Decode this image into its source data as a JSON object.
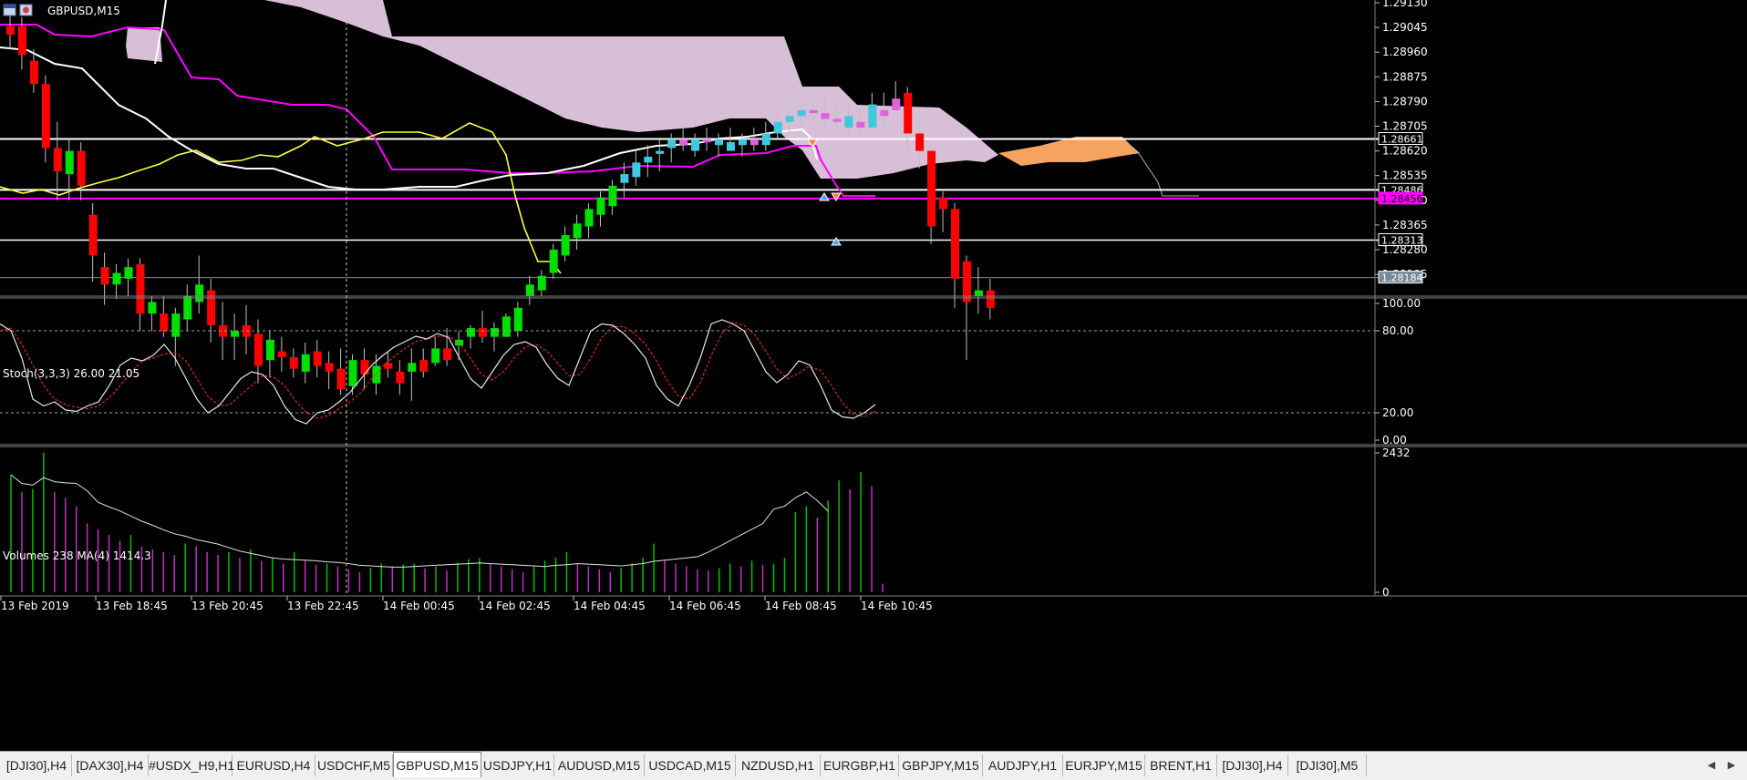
{
  "window": {
    "symbol_label": "GBPUSD,M15"
  },
  "indicators": {
    "stoch_label": "Stoch(3,3,3) 26.00 21.05",
    "volume_label": "Volumes 238 MA(4) 1414.3"
  },
  "main_axis": {
    "ticks": [
      "1.29130",
      "1.29045",
      "1.28960",
      "1.28875",
      "1.28790",
      "1.28705",
      "1.28620",
      "1.28535",
      "1.28450",
      "1.28365",
      "1.28280",
      "1.28195"
    ],
    "boxed": [
      {
        "label": "1.28661",
        "color": "#ffffff"
      },
      {
        "label": "1.28486",
        "color": "#ffffff"
      },
      {
        "label": "1.28456",
        "color": "#ff00ff"
      },
      {
        "label": "1.28313",
        "color": "#ffffff"
      },
      {
        "label": "1.28184",
        "color": "#778899"
      }
    ]
  },
  "stoch_axis": {
    "ticks": [
      "100.00",
      "80.00",
      "20.00",
      "0.00"
    ]
  },
  "volume_axis": {
    "ticks": [
      "2432",
      "0"
    ]
  },
  "time_axis": {
    "labels": [
      "13 Feb 2019",
      "13 Feb 18:45",
      "13 Feb 20:45",
      "13 Feb 22:45",
      "14 Feb 00:45",
      "14 Feb 02:45",
      "14 Feb 04:45",
      "14 Feb 06:45",
      "14 Feb 08:45",
      "14 Feb 10:45"
    ]
  },
  "tabs": [
    {
      "label": "[DJI30],H4",
      "active": false
    },
    {
      "label": "[DAX30],H4",
      "active": false
    },
    {
      "label": "#USDX_H9,H1",
      "active": false
    },
    {
      "label": "EURUSD,H4",
      "active": false
    },
    {
      "label": "USDCHF,M5",
      "active": false
    },
    {
      "label": "GBPUSD,M15",
      "active": true
    },
    {
      "label": "USDJPY,H1",
      "active": false
    },
    {
      "label": "AUDUSD,M15",
      "active": false
    },
    {
      "label": "USDCAD,M15",
      "active": false
    },
    {
      "label": "NZDUSD,H1",
      "active": false
    },
    {
      "label": "EURGBP,H1",
      "active": false
    },
    {
      "label": "GBPJPY,M15",
      "active": false
    },
    {
      "label": "AUDJPY,H1",
      "active": false
    },
    {
      "label": "EURJPY,M15",
      "active": false
    },
    {
      "label": "BRENT,H1",
      "active": false
    },
    {
      "label": "[DJI30],H4",
      "active": false
    },
    {
      "label": "[DJI30],M5",
      "active": false
    }
  ],
  "colors": {
    "bull": "#00e000",
    "bear": "#ff0000",
    "cloud": "#d8bfd8",
    "cloud_future": "#f4a460",
    "kijun": "#ff00ff",
    "tenkan": "#ffffff",
    "chikou": "#ffff40",
    "bull_in_cloud": "#40c8e0",
    "bear_in_cloud": "#e060e0"
  },
  "chart_data": {
    "type": "candlestick",
    "ohlc": [
      [
        1.2905,
        1.2909,
        1.2897,
        1.2902
      ],
      [
        1.2905,
        1.2908,
        1.289,
        1.2895
      ],
      [
        1.2893,
        1.2897,
        1.2882,
        1.2885
      ],
      [
        1.2885,
        1.2888,
        1.2858,
        1.2863
      ],
      [
        1.2863,
        1.2872,
        1.2845,
        1.2855
      ],
      [
        1.2854,
        1.2866,
        1.2845,
        1.2862
      ],
      [
        1.2862,
        1.2865,
        1.2845,
        1.285
      ],
      [
        1.284,
        1.2844,
        1.2817,
        1.2826
      ],
      [
        1.2822,
        1.2827,
        1.2809,
        1.2816
      ],
      [
        1.2816,
        1.2823,
        1.2811,
        1.282
      ],
      [
        1.2818,
        1.2825,
        1.2812,
        1.2822
      ],
      [
        1.2823,
        1.2825,
        1.28,
        1.2806
      ],
      [
        1.2806,
        1.2812,
        1.28,
        1.281
      ],
      [
        1.2806,
        1.2812,
        1.2798,
        1.28
      ],
      [
        1.2798,
        1.2808,
        1.2788,
        1.2806
      ],
      [
        1.2804,
        1.2816,
        1.28,
        1.2812
      ],
      [
        1.281,
        1.2826,
        1.2806,
        1.2816
      ],
      [
        1.2814,
        1.2818,
        1.2796,
        1.2802
      ],
      [
        1.2802,
        1.281,
        1.279,
        1.2798
      ],
      [
        1.2798,
        1.2806,
        1.279,
        1.28
      ],
      [
        1.2802,
        1.2809,
        1.2792,
        1.2798
      ],
      [
        1.2799,
        1.2804,
        1.2782,
        1.2788
      ],
      [
        1.279,
        1.28,
        1.2784,
        1.2797
      ],
      [
        1.2793,
        1.2798,
        1.2786,
        1.2791
      ],
      [
        1.2791,
        1.2794,
        1.2784,
        1.2787
      ],
      [
        1.2786,
        1.2796,
        1.2782,
        1.2792
      ],
      [
        1.2793,
        1.2797,
        1.2784,
        1.2788
      ],
      [
        1.2789,
        1.2793,
        1.278,
        1.2786
      ],
      [
        1.2787,
        1.2794,
        1.2778,
        1.278
      ],
      [
        1.2781,
        1.2792,
        1.2778,
        1.279
      ],
      [
        1.279,
        1.2794,
        1.278,
        1.2785
      ],
      [
        1.2782,
        1.2792,
        1.2778,
        1.2788
      ],
      [
        1.2789,
        1.2793,
        1.2784,
        1.2787
      ],
      [
        1.2786,
        1.279,
        1.2778,
        1.2782
      ],
      [
        1.2786,
        1.2794,
        1.2776,
        1.2789
      ],
      [
        1.279,
        1.2794,
        1.2784,
        1.2786
      ],
      [
        1.2789,
        1.2798,
        1.2788,
        1.2794
      ],
      [
        1.2794,
        1.2801,
        1.2788,
        1.279
      ],
      [
        1.2795,
        1.28,
        1.279,
        1.2797
      ],
      [
        1.2798,
        1.2802,
        1.2794,
        1.2801
      ],
      [
        1.2801,
        1.2807,
        1.2796,
        1.2798
      ],
      [
        1.2798,
        1.2803,
        1.2793,
        1.2801
      ],
      [
        1.2798,
        1.2806,
        1.2798,
        1.2805
      ],
      [
        1.28,
        1.281,
        1.2798,
        1.2808
      ],
      [
        1.2812,
        1.2819,
        1.2809,
        1.2816
      ],
      [
        1.2814,
        1.2821,
        1.2812,
        1.2819
      ],
      [
        1.282,
        1.283,
        1.2818,
        1.2828
      ],
      [
        1.2826,
        1.2836,
        1.2824,
        1.2833
      ],
      [
        1.2832,
        1.284,
        1.2828,
        1.2837
      ],
      [
        1.2836,
        1.2844,
        1.2832,
        1.2842
      ],
      [
        1.284,
        1.2848,
        1.2836,
        1.2846
      ],
      [
        1.2843,
        1.2852,
        1.284,
        1.285
      ],
      [
        1.2851,
        1.2858,
        1.2846,
        1.2854
      ],
      [
        1.2853,
        1.2862,
        1.285,
        1.2858
      ],
      [
        1.2858,
        1.2864,
        1.2853,
        1.286
      ],
      [
        1.2861,
        1.2866,
        1.2855,
        1.2862
      ],
      [
        1.2863,
        1.2868,
        1.2858,
        1.2866
      ],
      [
        1.2866,
        1.287,
        1.2862,
        1.2864
      ],
      [
        1.2862,
        1.2868,
        1.286,
        1.2866
      ],
      [
        1.2866,
        1.287,
        1.2862,
        1.2865
      ],
      [
        1.2864,
        1.2868,
        1.286,
        1.2866
      ],
      [
        1.2862,
        1.287,
        1.2862,
        1.2865
      ],
      [
        1.2864,
        1.2868,
        1.286,
        1.2866
      ],
      [
        1.2866,
        1.287,
        1.2862,
        1.2864
      ],
      [
        1.2864,
        1.2872,
        1.2862,
        1.2868
      ],
      [
        1.2868,
        1.2876,
        1.2866,
        1.2872
      ],
      [
        1.2872,
        1.2878,
        1.2868,
        1.2874
      ],
      [
        1.2874,
        1.288,
        1.287,
        1.2876
      ],
      [
        1.2876,
        1.288,
        1.2872,
        1.2875
      ],
      [
        1.2875,
        1.288,
        1.287,
        1.2873
      ],
      [
        1.2873,
        1.2878,
        1.287,
        1.2872
      ],
      [
        1.287,
        1.2878,
        1.2868,
        1.2874
      ],
      [
        1.2872,
        1.2876,
        1.2868,
        1.287
      ],
      [
        1.287,
        1.2882,
        1.2868,
        1.2878
      ],
      [
        1.2876,
        1.2882,
        1.287,
        1.2874
      ],
      [
        1.288,
        1.2886,
        1.2876,
        1.2876
      ],
      [
        1.2882,
        1.2884,
        1.2862,
        1.2868
      ],
      [
        1.2868,
        1.2872,
        1.2856,
        1.2862
      ],
      [
        1.2862,
        1.2864,
        1.283,
        1.2836
      ],
      [
        1.2846,
        1.2848,
        1.2834,
        1.2842
      ],
      [
        1.2842,
        1.2844,
        1.2808,
        1.2818
      ],
      [
        1.2824,
        1.2826,
        1.279,
        1.281
      ],
      [
        1.2812,
        1.2822,
        1.2806,
        1.2814
      ],
      [
        1.2814,
        1.2818,
        1.2804,
        1.2808
      ]
    ],
    "volume": [
      2050,
      1750,
      1800,
      2432,
      1750,
      1650,
      1500,
      1200,
      1100,
      1000,
      900,
      1000,
      800,
      750,
      700,
      650,
      850,
      800,
      700,
      650,
      700,
      600,
      750,
      550,
      600,
      500,
      700,
      550,
      480,
      500,
      450,
      400,
      350,
      420,
      500,
      450,
      480,
      500,
      420,
      450,
      380,
      520,
      580,
      600,
      500,
      450,
      400,
      350,
      450,
      550,
      600,
      700,
      500,
      450,
      400,
      350,
      420,
      500,
      600,
      850,
      550,
      500,
      450,
      400,
      380,
      420,
      500,
      450,
      550,
      480,
      500,
      600,
      1400,
      1500,
      1300,
      1600,
      1950,
      1800,
      2100,
      1850,
      150
    ],
    "volume_ma": [
      2050,
      1900,
      1870,
      2000,
      1930,
      1910,
      1900,
      1770,
      1570,
      1490,
      1420,
      1330,
      1240,
      1170,
      1090,
      1020,
      980,
      920,
      880,
      840,
      780,
      720,
      680,
      640,
      600,
      580,
      570,
      560,
      550,
      530,
      520,
      500,
      470,
      460,
      450,
      440,
      440,
      450,
      460,
      470,
      480,
      490,
      500,
      510,
      500,
      490,
      480,
      470,
      460,
      450,
      470,
      480,
      500,
      490,
      480,
      470,
      460,
      480,
      500,
      540,
      560,
      580,
      600,
      620,
      700,
      800,
      900,
      1000,
      1100,
      1200,
      1450,
      1500,
      1650,
      1750,
      1600,
      1414
    ],
    "stoch_main": [
      85,
      80,
      60,
      30,
      25,
      28,
      22,
      21,
      25,
      28,
      40,
      55,
      60,
      58,
      62,
      70,
      60,
      45,
      30,
      20,
      25,
      35,
      45,
      50,
      48,
      40,
      25,
      15,
      12,
      20,
      22,
      28,
      35,
      45,
      55,
      62,
      68,
      72,
      76,
      74,
      78,
      75,
      60,
      45,
      38,
      50,
      62,
      70,
      72,
      68,
      55,
      45,
      40,
      60,
      80,
      85,
      84,
      78,
      70,
      60,
      40,
      30,
      25,
      40,
      60,
      85,
      88,
      85,
      80,
      65,
      50,
      42,
      48,
      58,
      55,
      40,
      22,
      17,
      16,
      20,
      26
    ],
    "stoch_signal": [
      80,
      82,
      70,
      55,
      40,
      30,
      26,
      24,
      23,
      25,
      31,
      40,
      50,
      58,
      60,
      63,
      64,
      58,
      45,
      32,
      25,
      26,
      33,
      40,
      47,
      46,
      40,
      29,
      20,
      16,
      18,
      23,
      28,
      35,
      45,
      54,
      61,
      67,
      72,
      74,
      76,
      76,
      71,
      60,
      48,
      44,
      50,
      60,
      68,
      70,
      65,
      56,
      47,
      48,
      60,
      75,
      83,
      83,
      78,
      70,
      58,
      43,
      32,
      30,
      42,
      62,
      78,
      86,
      84,
      77,
      65,
      52,
      45,
      49,
      54,
      51,
      40,
      27,
      19,
      17,
      21
    ],
    "indicators": [
      "Ichimoku Kinko Hyo",
      "Stochastic(3,3,3)",
      "Volumes MA(4)"
    ]
  }
}
